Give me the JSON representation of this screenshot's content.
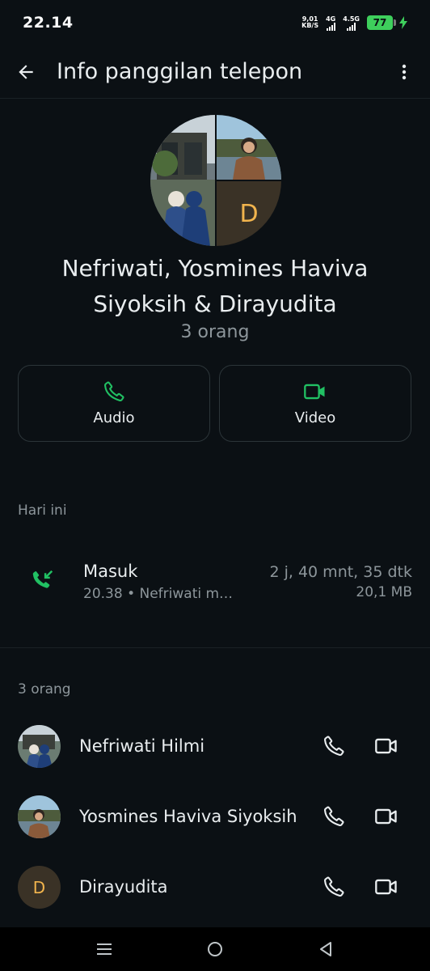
{
  "status_bar": {
    "time": "22.14",
    "net_speed_value": "9,01",
    "net_speed_unit": "KB/S",
    "signal1_label": "4G",
    "signal2_label": "4.5G",
    "battery": "77"
  },
  "app_bar": {
    "title": "Info panggilan telepon",
    "back_icon": "arrow-left-icon",
    "more_icon": "more-vertical-icon"
  },
  "group": {
    "avatar_letter": "D",
    "name": "Nefriwati, Yosmines Haviva Siyoksih & Dirayudita",
    "count": "3 orang"
  },
  "actions": {
    "audio_label": "Audio",
    "video_label": "Video",
    "accent": "#21c063"
  },
  "history": {
    "section_title": "Hari ini",
    "calls": [
      {
        "type": "Masuk",
        "detail": "20.38 • Nefriwati m…",
        "duration": "2 j, 40 mnt, 35 dtk",
        "size": "20,1 MB",
        "icon": "incoming-call-icon"
      }
    ]
  },
  "participants": {
    "section_title": "3 orang",
    "members": [
      {
        "name": "Nefriwati Hilmi",
        "avatar": "photo"
      },
      {
        "name": "Yosmines Haviva Siyoksih",
        "avatar": "photo"
      },
      {
        "name": "Dirayudita",
        "avatar_letter": "D"
      }
    ]
  },
  "nav_bar": {
    "buttons": [
      "menu-icon",
      "home-icon",
      "back-triangle-icon"
    ]
  }
}
